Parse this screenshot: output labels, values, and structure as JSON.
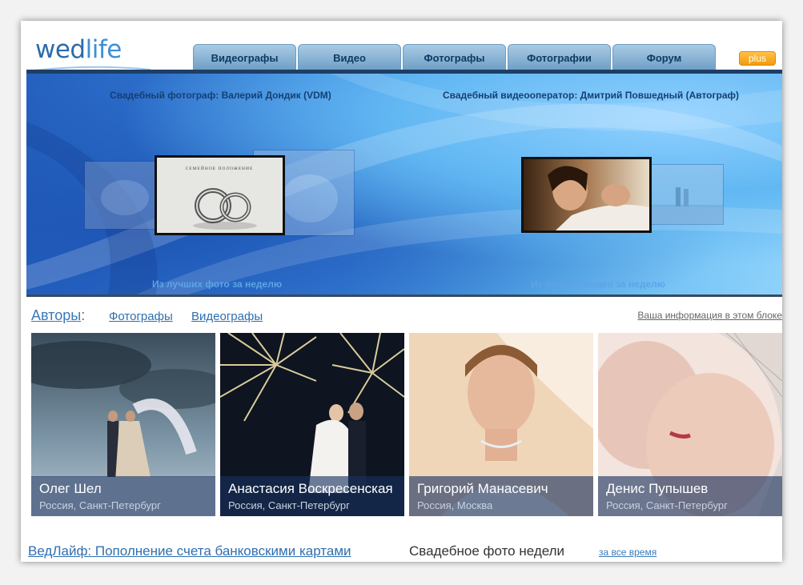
{
  "logo": {
    "wed": "wed",
    "life": "life"
  },
  "nav": {
    "tabs": [
      {
        "label": "Видеографы"
      },
      {
        "label": "Видео"
      },
      {
        "label": "Фотографы"
      },
      {
        "label": "Фотографии"
      },
      {
        "label": "Форум"
      }
    ],
    "plus_label": "plus"
  },
  "banner": {
    "photographer_title": "Свадебный фотограф: Валерий Дондик (VDM)",
    "videographer_title": "Свадебный видеооператор: Дмитрий Повшедный (Автограф)",
    "photo_caption": "Из лучших фото за неделю",
    "video_caption": "Из лучших видео за неделю",
    "photo_card_text": "СЕМЕЙНОЕ ПОЛОЖЕНИЕ"
  },
  "authors": {
    "label": "Авторы",
    "colon": ":",
    "tab_photographers": "Фотографы",
    "tab_videographers": "Видеографы",
    "info_link": "Ваша информация в этом блоке"
  },
  "cards": [
    {
      "name": "Олег Шел",
      "location": "Россия, Санкт-Петербург"
    },
    {
      "name": "Анастасия Воскресенская",
      "location": "Россия, Санкт-Петербург"
    },
    {
      "name": "Григорий Манасевич",
      "location": "Россия, Москва"
    },
    {
      "name": "Денис Пупышев",
      "location": "Россия, Санкт-Петербург"
    }
  ],
  "bottom": {
    "news_link": "ВедЛайф: Пополнение счета банковскими картами",
    "photo_of_week": "Свадебное фото недели",
    "all_time_link": "за все время"
  },
  "colors": {
    "accent": "#2f6fae",
    "tab_text": "#0f3a63",
    "plus_button": "#f29b0c",
    "banner_border": "#1d3e66"
  }
}
